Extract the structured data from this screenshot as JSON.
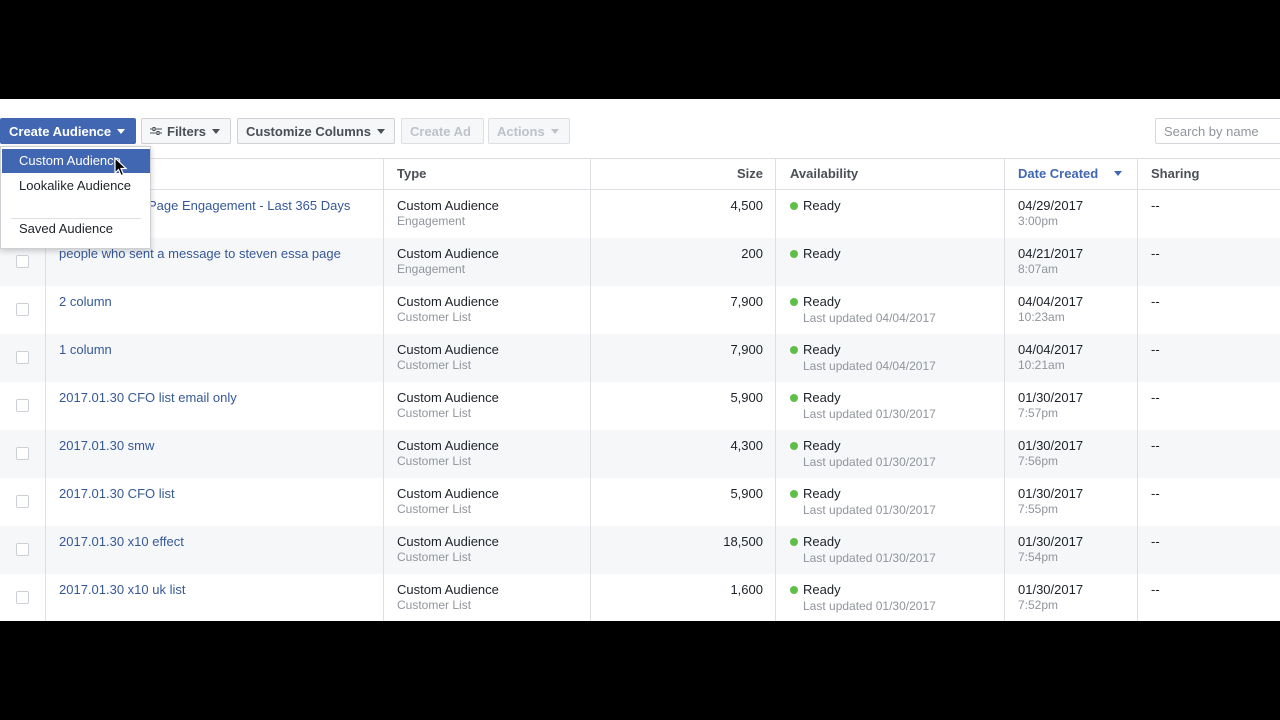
{
  "toolbar": {
    "create_audience": "Create Audience",
    "filters": "Filters",
    "customize_columns": "Customize Columns",
    "create_ad": "Create Ad",
    "actions": "Actions",
    "search_placeholder": "Search by name"
  },
  "dropdown": {
    "items": [
      "Custom Audience",
      "Lookalike Audience",
      "Saved Audience"
    ],
    "highlighted": "Custom Audience"
  },
  "columns": {
    "type": "Type",
    "size": "Size",
    "availability": "Availability",
    "date_created": "Date Created",
    "sharing": "Sharing"
  },
  "rows": [
    {
      "name": "Page Engagement - Last 365 Days",
      "type": "Custom Audience",
      "subtype": "Engagement",
      "size": "4,500",
      "status": "Ready",
      "status_sub": "",
      "date": "04/29/2017",
      "time": "3:00pm",
      "sharing": "--"
    },
    {
      "name": "people who sent a message to steven essa page",
      "type": "Custom Audience",
      "subtype": "Engagement",
      "size": "200",
      "status": "Ready",
      "status_sub": "",
      "date": "04/21/2017",
      "time": "8:07am",
      "sharing": "--"
    },
    {
      "name": "2 column",
      "type": "Custom Audience",
      "subtype": "Customer List",
      "size": "7,900",
      "status": "Ready",
      "status_sub": "Last updated 04/04/2017",
      "date": "04/04/2017",
      "time": "10:23am",
      "sharing": "--"
    },
    {
      "name": "1 column",
      "type": "Custom Audience",
      "subtype": "Customer List",
      "size": "7,900",
      "status": "Ready",
      "status_sub": "Last updated 04/04/2017",
      "date": "04/04/2017",
      "time": "10:21am",
      "sharing": "--"
    },
    {
      "name": "2017.01.30 CFO list email only",
      "type": "Custom Audience",
      "subtype": "Customer List",
      "size": "5,900",
      "status": "Ready",
      "status_sub": "Last updated 01/30/2017",
      "date": "01/30/2017",
      "time": "7:57pm",
      "sharing": "--"
    },
    {
      "name": "2017.01.30 smw",
      "type": "Custom Audience",
      "subtype": "Customer List",
      "size": "4,300",
      "status": "Ready",
      "status_sub": "Last updated 01/30/2017",
      "date": "01/30/2017",
      "time": "7:56pm",
      "sharing": "--"
    },
    {
      "name": "2017.01.30 CFO list",
      "type": "Custom Audience",
      "subtype": "Customer List",
      "size": "5,900",
      "status": "Ready",
      "status_sub": "Last updated 01/30/2017",
      "date": "01/30/2017",
      "time": "7:55pm",
      "sharing": "--"
    },
    {
      "name": "2017.01.30 x10 effect",
      "type": "Custom Audience",
      "subtype": "Customer List",
      "size": "18,500",
      "status": "Ready",
      "status_sub": "Last updated 01/30/2017",
      "date": "01/30/2017",
      "time": "7:54pm",
      "sharing": "--"
    },
    {
      "name": "2017.01.30 x10 uk list",
      "type": "Custom Audience",
      "subtype": "Customer List",
      "size": "1,600",
      "status": "Ready",
      "status_sub": "Last updated 01/30/2017",
      "date": "01/30/2017",
      "time": "7:52pm",
      "sharing": "--"
    }
  ],
  "colors": {
    "accent": "#4267b2",
    "link": "#365899",
    "ready": "#5fbe4a",
    "muted": "#90949c"
  },
  "icons": {
    "filters": "sliders-icon",
    "caret": "caret-down-icon",
    "status": "status-dot-icon",
    "cursor": "mouse-pointer-icon"
  }
}
